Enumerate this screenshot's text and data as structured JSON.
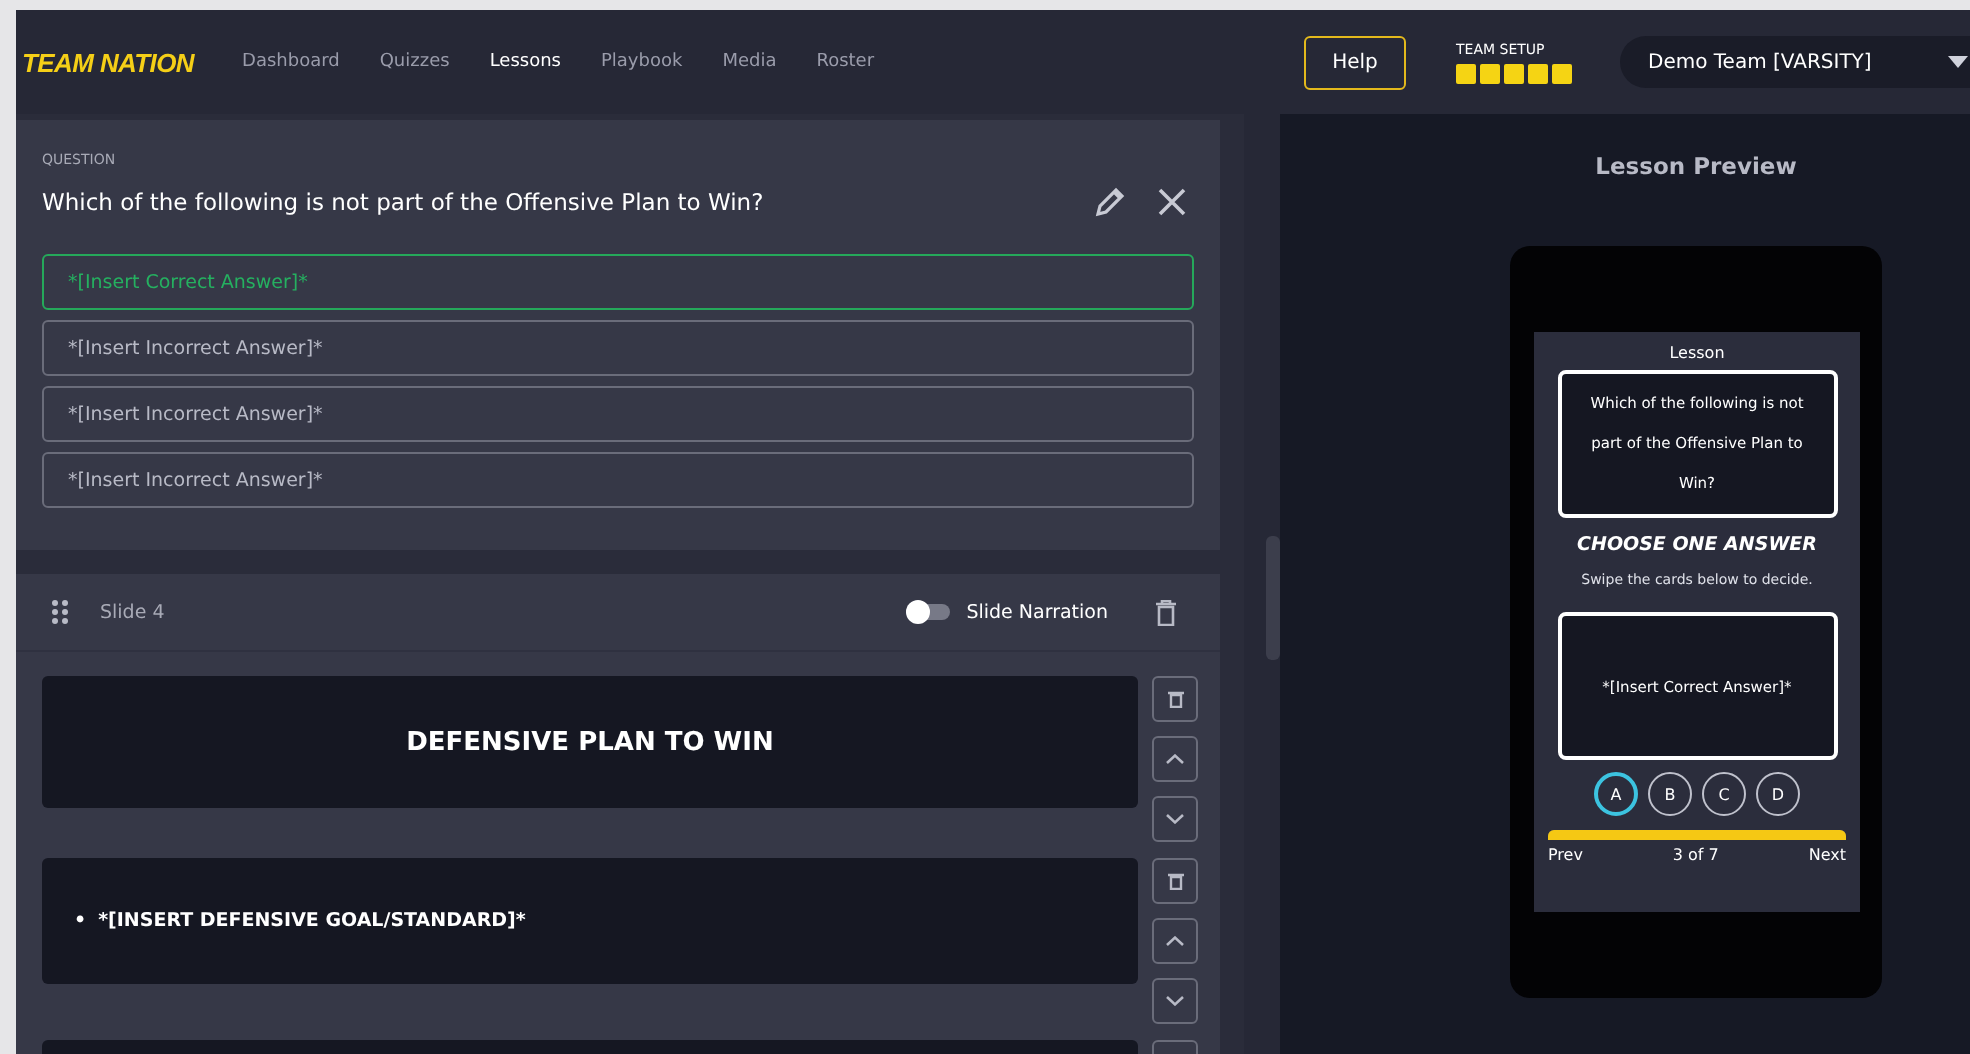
{
  "nav": {
    "logo": "TEAM NATION",
    "items": [
      {
        "label": "Dashboard",
        "selected": false
      },
      {
        "label": "Quizzes",
        "selected": false
      },
      {
        "label": "Lessons",
        "selected": true
      },
      {
        "label": "Playbook",
        "selected": false
      },
      {
        "label": "Media",
        "selected": false
      },
      {
        "label": "Roster",
        "selected": false
      }
    ],
    "help": "Help",
    "team_setup": {
      "label": "TEAM SETUP",
      "steps": [
        {
          "done": true
        },
        {
          "done": true
        },
        {
          "done": true
        },
        {
          "done": true
        },
        {
          "done": true
        }
      ]
    },
    "team_select": {
      "value": "Demo Team [VARSITY]"
    }
  },
  "question": {
    "label": "QUESTION",
    "text": "Which of the following is not part of the Offensive Plan to Win?",
    "answers": [
      {
        "text": "*[Insert Correct Answer]*",
        "correct": true
      },
      {
        "text": "*[Insert Incorrect Answer]*",
        "correct": false
      },
      {
        "text": "*[Insert Incorrect Answer]*",
        "correct": false
      },
      {
        "text": "*[Insert Incorrect Answer]*",
        "correct": false
      }
    ]
  },
  "slide": {
    "title": "Slide 4",
    "narration": {
      "label": "Slide Narration",
      "on": false
    },
    "blocks": [
      {
        "kind": "heading",
        "text": "DEFENSIVE PLAN TO WIN"
      },
      {
        "kind": "bullets",
        "items": [
          {
            "bullet": "•",
            "text": "*[INSERT DEFENSIVE GOAL/STANDARD]*"
          }
        ]
      },
      {
        "kind": "blank"
      }
    ]
  },
  "preview": {
    "title": "Lesson Preview",
    "phone": {
      "header": "Lesson",
      "question": "Which of the following is not part of the Offensive Plan to Win?",
      "prompt": "CHOOSE ONE ANSWER",
      "hint": "Swipe the cards below to decide.",
      "card": "*[Insert Correct Answer]*",
      "options": [
        {
          "label": "A",
          "selected": true
        },
        {
          "label": "B",
          "selected": false
        },
        {
          "label": "C",
          "selected": false
        },
        {
          "label": "D",
          "selected": false
        }
      ],
      "progress": {
        "level": 1
      },
      "prev": "Prev",
      "counter": "3 of 7",
      "next": "Next"
    }
  }
}
